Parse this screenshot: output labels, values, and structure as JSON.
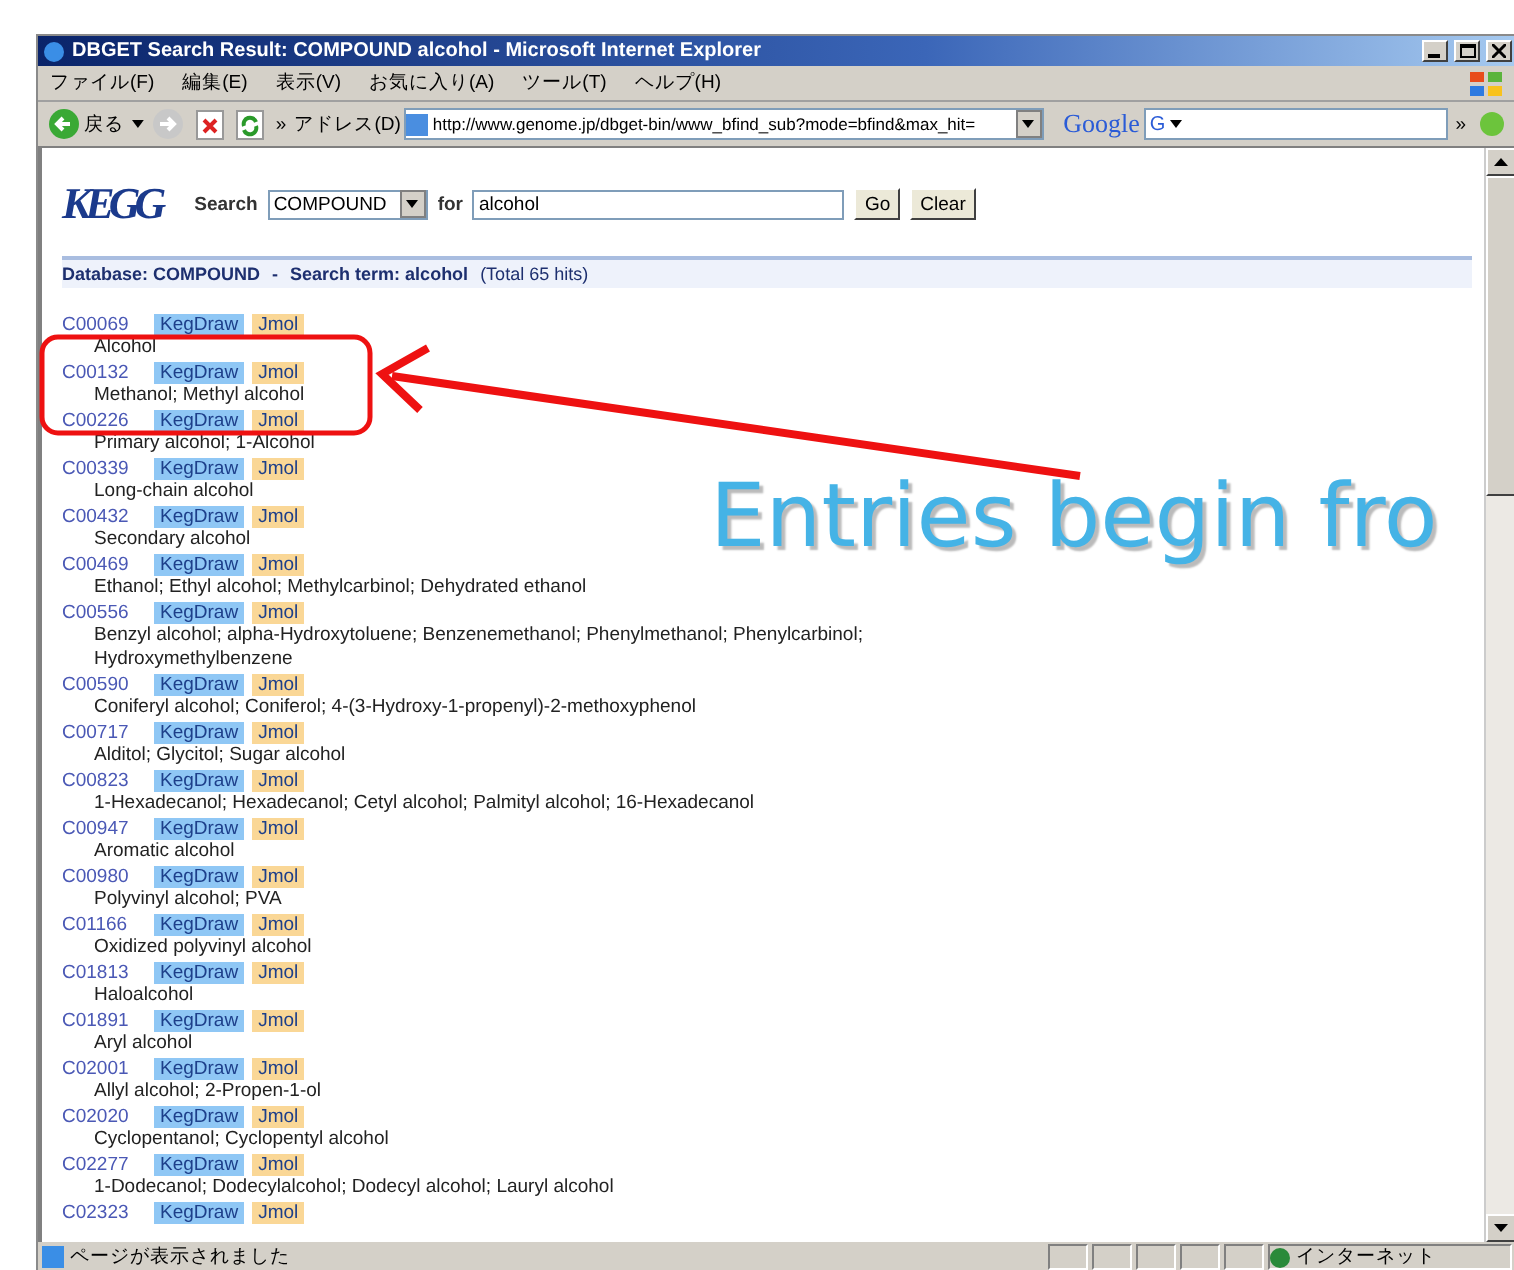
{
  "window": {
    "title": "DBGET Search Result: COMPOUND alcohol - Microsoft Internet Explorer"
  },
  "menu": [
    "ファイル(F)",
    "編集(E)",
    "表示(V)",
    "お気に入り(A)",
    "ツール(T)",
    "ヘルプ(H)"
  ],
  "toolbar": {
    "back_label": "戻る",
    "more": "»",
    "address_label": "アドレス(D)",
    "url": "http://www.genome.jp/dbget-bin/www_bfind_sub?mode=bfind&max_hit=",
    "search_brand": "Google",
    "search_glyph": "G",
    "more_right": "»"
  },
  "search_form": {
    "logo": "KEGG",
    "label": "Search",
    "database": "COMPOUND",
    "for_label": "for",
    "query": "alcohol",
    "buttons": [
      "Go",
      "Clear"
    ]
  },
  "summary": {
    "database": "Database: COMPOUND",
    "separator": "-",
    "term": "Search term: alcohol",
    "total": "(Total 65 hits)"
  },
  "entries": [
    {
      "id": "C00069",
      "links": [
        "KegDraw",
        "Jmol"
      ],
      "name": "Alcohol"
    },
    {
      "id": "C00132",
      "links": [
        "KegDraw",
        "Jmol"
      ],
      "name": "Methanol; Methyl alcohol"
    },
    {
      "id": "C00226",
      "links": [
        "KegDraw",
        "Jmol"
      ],
      "name": "Primary alcohol; 1-Alcohol"
    },
    {
      "id": "C00339",
      "links": [
        "KegDraw",
        "Jmol"
      ],
      "name": "Long-chain alcohol"
    },
    {
      "id": "C00432",
      "links": [
        "KegDraw",
        "Jmol"
      ],
      "name": "Secondary alcohol"
    },
    {
      "id": "C00469",
      "links": [
        "KegDraw",
        "Jmol"
      ],
      "name": "Ethanol; Ethyl alcohol; Methylcarbinol; Dehydrated ethanol"
    },
    {
      "id": "C00556",
      "links": [
        "KegDraw",
        "Jmol"
      ],
      "name": "Benzyl alcohol; alpha-Hydroxytoluene; Benzenemethanol; Phenylmethanol; Phenylcarbinol; Hydroxymethylbenzene"
    },
    {
      "id": "C00590",
      "links": [
        "KegDraw",
        "Jmol"
      ],
      "name": "Coniferyl alcohol; Coniferol; 4-(3-Hydroxy-1-propenyl)-2-methoxyphenol"
    },
    {
      "id": "C00717",
      "links": [
        "KegDraw",
        "Jmol"
      ],
      "name": "Alditol; Glycitol; Sugar alcohol"
    },
    {
      "id": "C00823",
      "links": [
        "KegDraw",
        "Jmol"
      ],
      "name": "1-Hexadecanol; Hexadecanol; Cetyl alcohol; Palmityl alcohol; 16-Hexadecanol"
    },
    {
      "id": "C00947",
      "links": [
        "KegDraw",
        "Jmol"
      ],
      "name": "Aromatic alcohol"
    },
    {
      "id": "C00980",
      "links": [
        "KegDraw",
        "Jmol"
      ],
      "name": "Polyvinyl alcohol; PVA"
    },
    {
      "id": "C01166",
      "links": [
        "KegDraw",
        "Jmol"
      ],
      "name": "Oxidized polyvinyl alcohol"
    },
    {
      "id": "C01813",
      "links": [
        "KegDraw",
        "Jmol"
      ],
      "name": "Haloalcohol"
    },
    {
      "id": "C01891",
      "links": [
        "KegDraw",
        "Jmol"
      ],
      "name": "Aryl alcohol"
    },
    {
      "id": "C02001",
      "links": [
        "KegDraw",
        "Jmol"
      ],
      "name": "Allyl alcohol; 2-Propen-1-ol"
    },
    {
      "id": "C02020",
      "links": [
        "KegDraw",
        "Jmol"
      ],
      "name": "Cyclopentanol; Cyclopentyl alcohol"
    },
    {
      "id": "C02277",
      "links": [
        "KegDraw",
        "Jmol"
      ],
      "name": "1-Dodecanol; Dodecylalcohol; Dodecyl alcohol; Lauryl alcohol"
    },
    {
      "id": "C02323",
      "links": [
        "KegDraw",
        "Jmol"
      ]
    }
  ],
  "annotation": {
    "text": "Entries begin fro"
  },
  "status_bar": {
    "message": "ページが表示されました",
    "zone": "インターネット"
  }
}
